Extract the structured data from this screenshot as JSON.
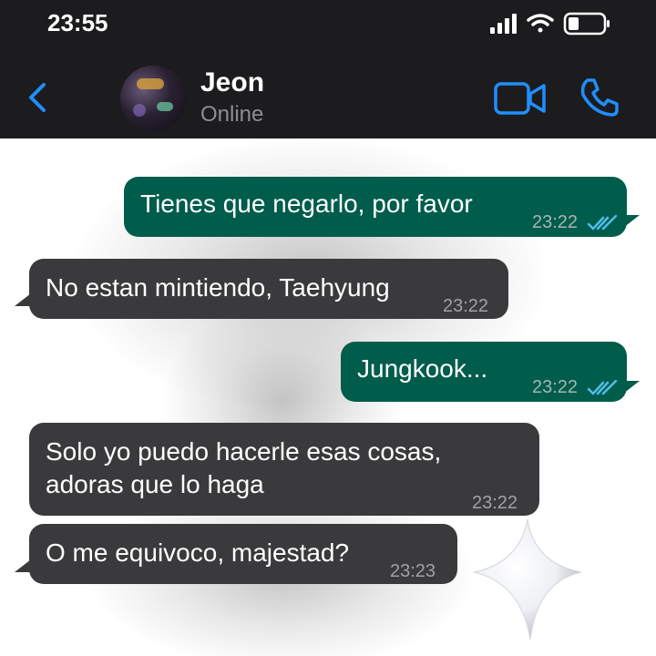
{
  "status_bar": {
    "time": "23:55",
    "icons": [
      "signal-icon",
      "wifi-icon",
      "battery-icon"
    ]
  },
  "header": {
    "back_icon": "chevron-left-icon",
    "contact_name": "Jeon",
    "contact_status": "Online",
    "actions": [
      "video-call-icon",
      "phone-icon"
    ],
    "accent_color": "#1f8fff"
  },
  "messages": [
    {
      "direction": "outgoing",
      "text": "Tienes que negarlo, por favor",
      "time": "23:22",
      "read": true
    },
    {
      "direction": "incoming",
      "text": "No estan mintiendo, Taehyung",
      "time": "23:22"
    },
    {
      "direction": "outgoing",
      "text": "Jungkook...",
      "time": "23:22",
      "read": true
    },
    {
      "direction": "incoming",
      "text_line1": "Solo yo puedo hacerle esas cosas,",
      "text_line2": "adoras que lo haga",
      "time": "23:22"
    },
    {
      "direction": "incoming",
      "text": "O me equivoco, majestad?",
      "time": "23:23"
    }
  ],
  "colors": {
    "outgoing_bubble": "#005c4b",
    "incoming_bubble": "#3a3a3c",
    "header_bg": "#1c1c1e",
    "read_ticks": "#53bdeb"
  },
  "decoration": "sparkle-star"
}
